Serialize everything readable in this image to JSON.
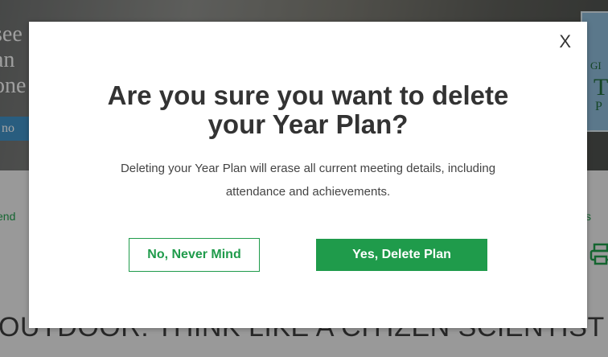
{
  "background": {
    "hero_lines": [
      "see",
      "an",
      "one"
    ],
    "hero_button": "no",
    "badge_lines": [
      "GI",
      "T",
      "P"
    ],
    "left_link": "end",
    "right_link": "s",
    "print_icon": "printer-icon",
    "section_heading": "OUTDOOR: THINK LIKE A CITIZEN SCIENTIST"
  },
  "modal": {
    "close_label": "X",
    "title": "Are you sure you want to delete your Year Plan?",
    "message": "Deleting your Year Plan will erase all current meeting details, including attendance and achievements.",
    "cancel_label": "No, Never Mind",
    "confirm_label": "Yes, Delete Plan"
  },
  "colors": {
    "accent": "#1f9b4b",
    "text": "#333333",
    "overlay": "rgba(0,0,0,0.35)"
  }
}
